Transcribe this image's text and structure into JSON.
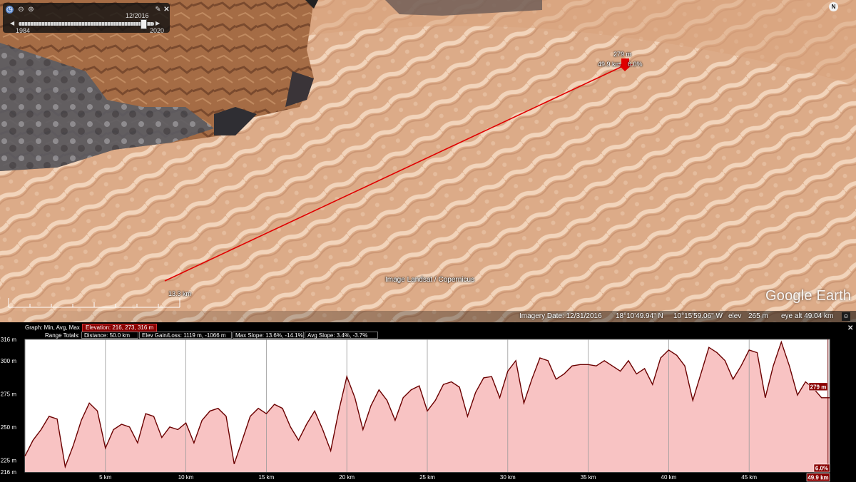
{
  "time_slider": {
    "current": "12/2016",
    "start": "1984",
    "end": "2020",
    "position": 0.92,
    "icons": [
      "clock-icon",
      "zoom-out-icon",
      "zoom-in-icon",
      "wrench-icon",
      "close-icon",
      "step-back-icon",
      "step-forward-icon"
    ]
  },
  "compass": {
    "label": "N"
  },
  "path_marker": {
    "elevation": "279 m",
    "distance": "49.9 km",
    "slope": "6.0%"
  },
  "map": {
    "credit": "Image Landsat / Copernicus",
    "logo": "Google Earth",
    "scale": "13.3 km",
    "path_color": "#dd0000"
  },
  "status_bar": {
    "imagery_date": "Imagery Date: 12/31/2016",
    "lat": "18°10'49.94\" N",
    "lon": "10°15'59.06\" W",
    "elev_label": "elev",
    "elev": "265 m",
    "eye_alt": "eye alt  49.04 km"
  },
  "elevation_panel": {
    "graph_label": "Graph: Min, Avg, Max",
    "elevation_stat": "Elevation: 216, 273, 316 m",
    "range_totals_label": "Range Totals:",
    "distance": "Distance: 50.0 km",
    "gain_loss": "Elev Gain/Loss: 1119 m, -1066 m",
    "max_slope": "Max Slope: 13.6%, -14.1%",
    "avg_slope": "Avg Slope: 3.4%, -3.7%",
    "cursor_elev": "279 m",
    "cursor_slope": "6.0%",
    "cursor_dist": "49.9 km",
    "close_icon": "close-icon",
    "colors": {
      "fill": "#f8c3c3",
      "line": "#6b0000",
      "stat_box": "#8a0000"
    }
  },
  "chart_data": {
    "type": "area",
    "y_ticks": [
      "316 m",
      "300 m",
      "275 m",
      "250 m",
      "225 m",
      "216 m"
    ],
    "y_tick_values": [
      316,
      300,
      275,
      250,
      225,
      216
    ],
    "x_ticks": [
      "5 km",
      "10 km",
      "15 km",
      "20 km",
      "25 km",
      "30 km",
      "35 km",
      "40 km",
      "45 km",
      "49.9 km"
    ],
    "x_tick_values": [
      5,
      10,
      15,
      20,
      25,
      30,
      35,
      40,
      45
    ],
    "xlim": [
      0,
      50
    ],
    "ylim": [
      216,
      316
    ],
    "grid": true,
    "x": [
      0,
      0.5,
      1,
      1.5,
      2,
      2.5,
      3,
      3.5,
      4,
      4.5,
      5,
      5.5,
      6,
      6.5,
      7,
      7.5,
      8,
      8.5,
      9,
      9.5,
      10,
      10.5,
      11,
      11.5,
      12,
      12.5,
      13,
      13.5,
      14,
      14.5,
      15,
      15.5,
      16,
      16.5,
      17,
      17.5,
      18,
      18.5,
      19,
      19.5,
      20,
      20.5,
      21,
      21.5,
      22,
      22.5,
      23,
      23.5,
      24,
      24.5,
      25,
      25.5,
      26,
      26.5,
      27,
      27.5,
      28,
      28.5,
      29,
      29.5,
      30,
      30.5,
      31,
      31.5,
      32,
      32.5,
      33,
      33.5,
      34,
      34.5,
      35,
      35.5,
      36,
      36.5,
      37,
      37.5,
      38,
      38.5,
      39,
      39.5,
      40,
      40.5,
      41,
      41.5,
      42,
      42.5,
      43,
      43.5,
      44,
      44.5,
      45,
      45.5,
      46,
      46.5,
      47,
      47.5,
      48,
      48.5,
      49,
      49.5,
      50
    ],
    "y": [
      228,
      240,
      248,
      258,
      256,
      220,
      236,
      255,
      268,
      262,
      234,
      248,
      252,
      250,
      238,
      260,
      258,
      242,
      250,
      248,
      253,
      238,
      255,
      262,
      264,
      258,
      222,
      240,
      258,
      264,
      260,
      267,
      264,
      250,
      240,
      252,
      262,
      248,
      232,
      262,
      288,
      272,
      248,
      266,
      278,
      270,
      255,
      272,
      278,
      281,
      262,
      270,
      282,
      284,
      280,
      258,
      276,
      287,
      288,
      272,
      292,
      300,
      268,
      286,
      302,
      300,
      286,
      290,
      296,
      297,
      297,
      296,
      300,
      296,
      292,
      300,
      290,
      294,
      282,
      302,
      308,
      304,
      296,
      270,
      290,
      310,
      306,
      300,
      286,
      296,
      308,
      306,
      272,
      296,
      314,
      296,
      274,
      284,
      279,
      272,
      272
    ]
  }
}
